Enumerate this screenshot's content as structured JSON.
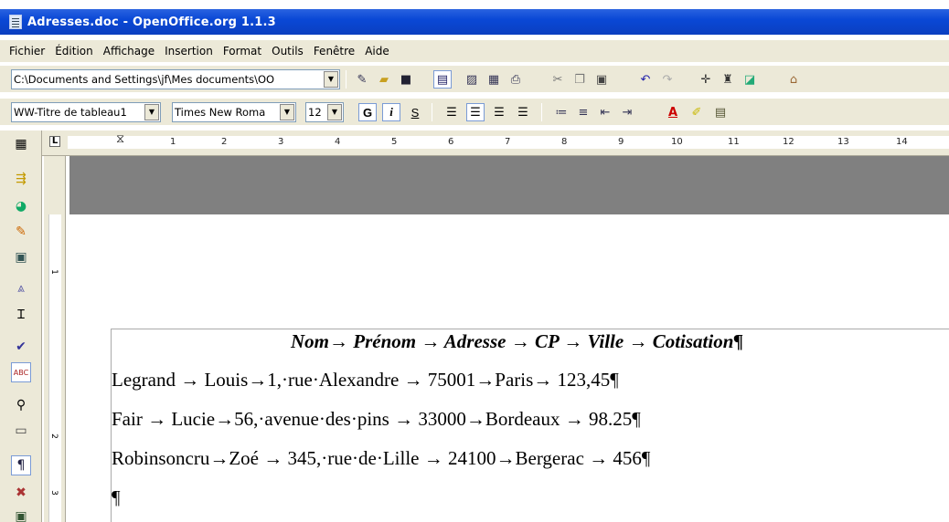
{
  "window": {
    "title": "Adresses.doc - OpenOffice.org 1.1.3"
  },
  "menu": [
    {
      "label": "Fichier"
    },
    {
      "label": "Édition"
    },
    {
      "label": "Affichage"
    },
    {
      "label": "Insertion"
    },
    {
      "label": "Format"
    },
    {
      "label": "Outils"
    },
    {
      "label": "Fenêtre"
    },
    {
      "label": "Aide"
    }
  ],
  "toolbar1": {
    "path": "C:\\Documents and Settings\\jf\\Mes documents\\OO"
  },
  "toolbar2": {
    "style": "WW-Titre de tableau1",
    "font": "Times New Roma",
    "size": "12",
    "bold": "G",
    "italic": "i",
    "underline": "S"
  },
  "ruler": {
    "numbers": [
      "1",
      "2",
      "3",
      "4",
      "5",
      "6",
      "7",
      "8",
      "9",
      "10",
      "11",
      "12",
      "13",
      "14"
    ]
  },
  "vruler": {
    "numbers": [
      "1",
      "2",
      "3"
    ]
  },
  "document": {
    "header": "Nom→ Prénom  →  Adresse  →  CP → Ville → Cotisation¶",
    "rows": [
      "Legrand  →  Louis→1,·rue·Alexandre  →  75001→Paris→ 123,45¶",
      "Fair → Lucie→56,·avenue·des·pins → 33000→Bordeaux  →  98.25¶",
      "Robinsoncru→Zoé → 345,·rue·de·Lille  →  24100→Bergerac  →  456¶"
    ],
    "empty_para": "¶"
  }
}
